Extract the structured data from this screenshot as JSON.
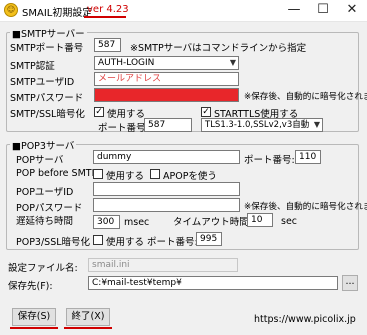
{
  "window": {
    "app_icon_glyph": "☺",
    "title": "SMAIL初期設定",
    "version": "ver 4.23",
    "minimize": "—",
    "maximize": "☐",
    "close": "✕"
  },
  "smtp": {
    "group_title": "■SMTPサーバー",
    "port_label": "SMTPポート番号",
    "port_value": "587",
    "port_note": "※SMTPサーバはコマンドラインから指定",
    "auth_label": "SMTP認証",
    "auth_value": "AUTH-LOGIN",
    "user_label": "SMTPユーザID",
    "user_value": "メールアドレス",
    "password_label": "SMTPパスワード",
    "password_note": "※保存後、自動的に暗号化されます",
    "ssl_label": "SMTP/SSL暗号化",
    "ssl_checkbox_label": "使用する",
    "ssl_checked": true,
    "ssl_port_label": "ポート番号:",
    "ssl_port_value": "587",
    "starttls_label": "STARTTLS使用する",
    "starttls_checked": true,
    "tls_value": "TLS1.3-1.0,SSLv2,v3自動"
  },
  "pop3": {
    "group_title": "■POP3サーバ",
    "server_label": "POPサーバ",
    "server_value": "dummy",
    "port_label": "ポート番号:",
    "port_value": "110",
    "pbs_label": "POP before SMTP",
    "pbs_checkbox_label": "使用する",
    "apop_label": "APOPを使う",
    "user_label": "POPユーザID",
    "user_value": "",
    "password_label": "POPパスワード",
    "password_note": "※保存後、自動的に暗号化されます",
    "wait_label": "遅延待ち時間",
    "wait_value": "300",
    "wait_unit": "msec",
    "timeout_label": "タイムアウト時間",
    "timeout_value": "10",
    "timeout_unit": "sec",
    "ssl_label": "POP3/SSL暗号化",
    "ssl_checkbox_label": "使用する",
    "ssl_port_label": "ポート番号:",
    "ssl_port_value": "995"
  },
  "files": {
    "settings_label": "設定ファイル名:",
    "settings_value": "smail.ini",
    "save_dest_label": "保存先(F):",
    "save_dest_value": "C:¥mail-test¥temp¥",
    "browse_label": "..."
  },
  "footer": {
    "save_label": "保存(S)",
    "exit_label": "終了(X)",
    "url": "https://www.picolix.jp"
  },
  "colors": {
    "accent_red": "#d00000",
    "password_bar": "#e8262a"
  }
}
